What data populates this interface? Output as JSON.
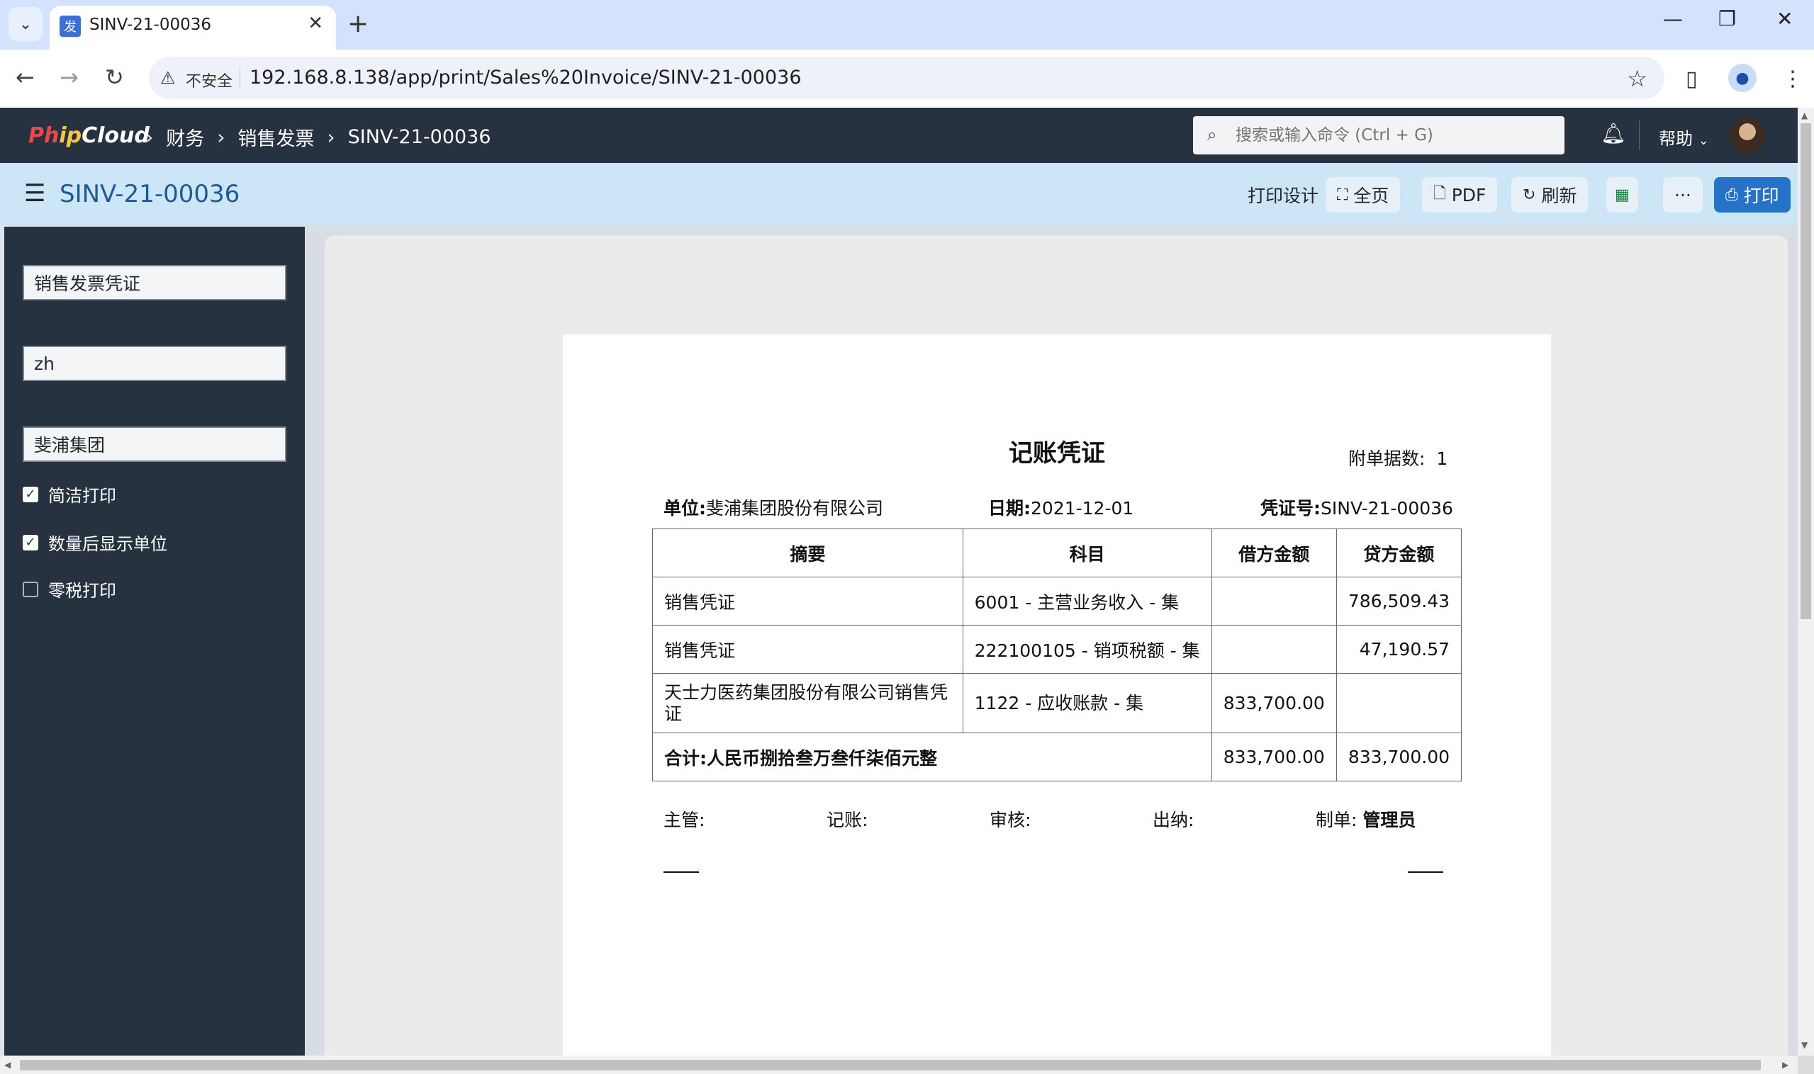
{
  "browser": {
    "tab_title": "SINV-21-00036",
    "tab_favicon": "发",
    "insecure_label": "不安全",
    "url": "192.168.8.138/app/print/Sales%20Invoice/SINV-21-00036"
  },
  "navbar": {
    "logo": {
      "p1": "Ph",
      "p2": "ip",
      "p3": "Cloud"
    },
    "breadcrumbs": [
      "财务",
      "销售发票",
      "SINV-21-00036"
    ],
    "search_placeholder": "搜索或输入命令 (Ctrl + G)",
    "help_label": "帮助"
  },
  "page": {
    "title": "SINV-21-00036",
    "actions": {
      "print_design": "打印设计",
      "full_page": "全页",
      "pdf": "PDF",
      "refresh": "刷新",
      "more": "···",
      "print": "打印"
    }
  },
  "sidebar": {
    "print_format": "销售发票凭证",
    "language": "zh",
    "letterhead": "斐浦集团",
    "checkboxes": [
      {
        "label": "简洁打印",
        "checked": true
      },
      {
        "label": "数量后显示单位",
        "checked": true
      },
      {
        "label": "零税打印",
        "checked": false
      }
    ]
  },
  "voucher": {
    "title": "记账凭证",
    "attachments_label": "附单据数:",
    "attachments_value": "1",
    "unit_label": "单位:",
    "unit_value": "斐浦集团股份有限公司",
    "date_label": "日期:",
    "date_value": "2021-12-01",
    "voucher_no_label": "凭证号:",
    "voucher_no_value": "SINV-21-00036",
    "headers": [
      "摘要",
      "科目",
      "借方金额",
      "贷方金额"
    ],
    "rows": [
      {
        "summary": "销售凭证",
        "account": "6001 - 主营业务收入 - 集",
        "debit": "",
        "credit": "786,509.43"
      },
      {
        "summary": "销售凭证",
        "account": "222100105 - 销项税额 - 集",
        "debit": "",
        "credit": "47,190.57"
      },
      {
        "summary": "天士力医药集团股份有限公司销售凭证",
        "account": "1122 - 应收账款 - 集",
        "debit": "833,700.00",
        "credit": ""
      }
    ],
    "total_label": "合计:人民币捌拾叁万叁仟柒佰元整",
    "total_debit": "833,700.00",
    "total_credit": "833,700.00",
    "signs": {
      "supervisor": "主管:",
      "bookkeeper": "记账:",
      "auditor": "审核:",
      "cashier": "出纳:",
      "preparer_label": "制单:",
      "preparer_value": "管理员"
    }
  }
}
